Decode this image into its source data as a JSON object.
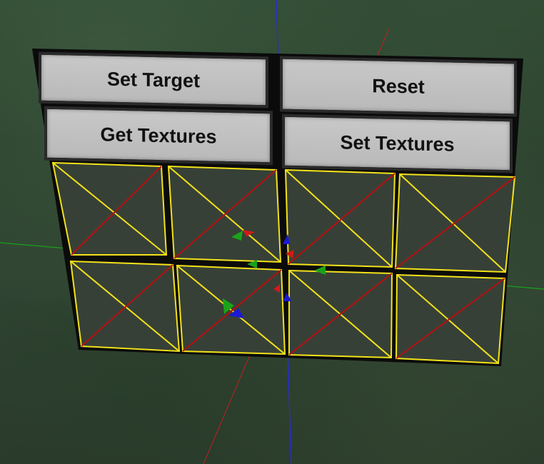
{
  "panel": {
    "buttons": {
      "set_target": "Set Target",
      "reset": "Reset",
      "get_textures": "Get Textures",
      "set_textures": "Set Textures"
    },
    "texture_slots": [
      {
        "row": 1,
        "col": 1,
        "state": "empty"
      },
      {
        "row": 1,
        "col": 2,
        "state": "empty"
      },
      {
        "row": 1,
        "col": 3,
        "state": "empty"
      },
      {
        "row": 1,
        "col": 4,
        "state": "empty"
      },
      {
        "row": 2,
        "col": 1,
        "state": "empty"
      },
      {
        "row": 2,
        "col": 2,
        "state": "empty"
      },
      {
        "row": 2,
        "col": 3,
        "state": "empty"
      },
      {
        "row": 2,
        "col": 4,
        "state": "empty"
      }
    ]
  },
  "colors": {
    "axis_x": "#d21a1a",
    "axis_y": "#1aa31a",
    "axis_z": "#1a1ad2",
    "slot_border": "#f2e21a",
    "slot_cross_a": "#f2e21a",
    "slot_cross_b": "#b80f0f",
    "button_face": "#c0c0c0",
    "frame": "#0a0a0a"
  }
}
